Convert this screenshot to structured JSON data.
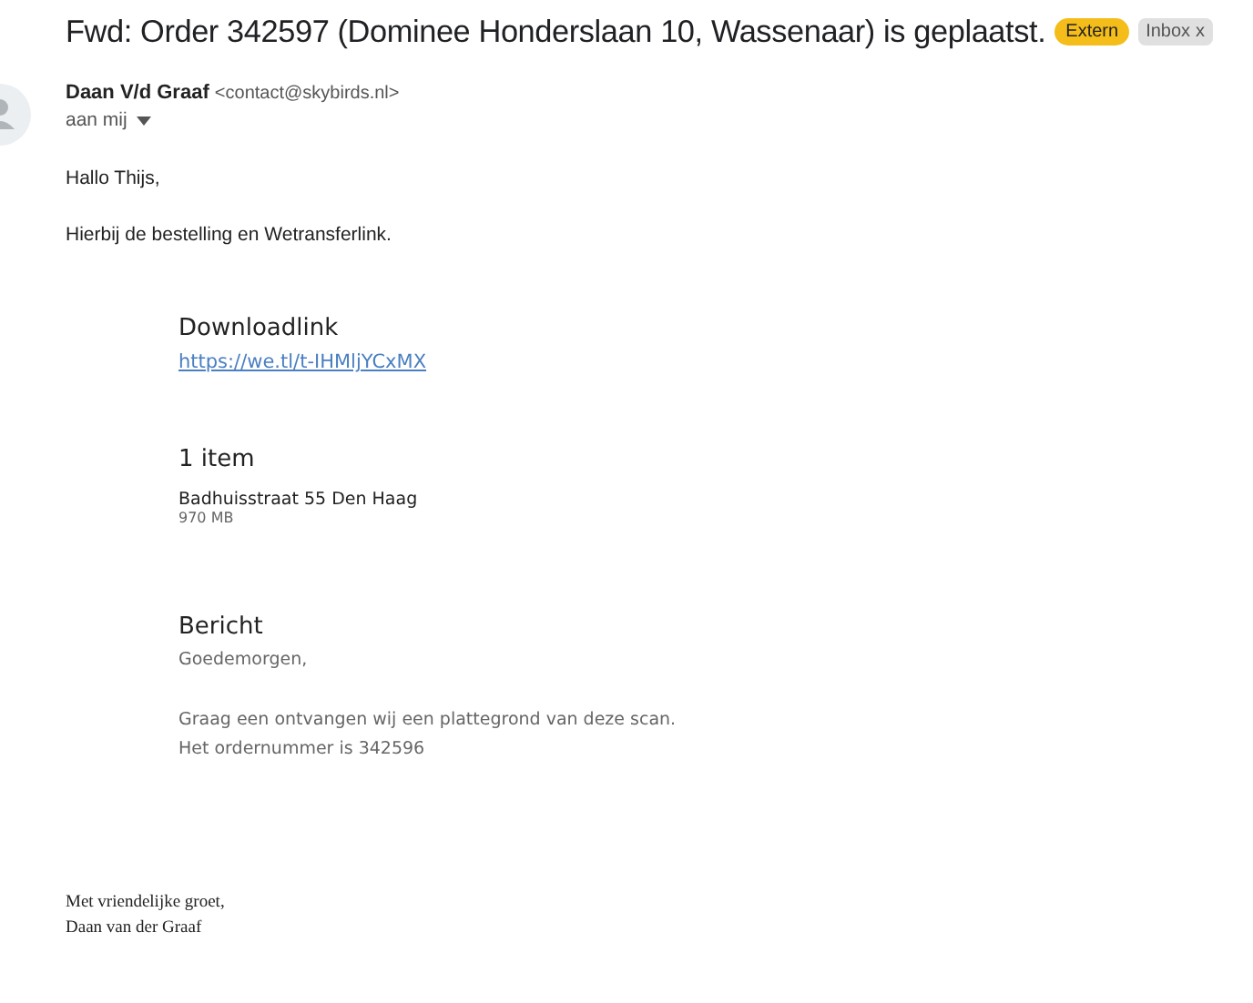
{
  "subject": "Fwd: Order 342597 (Dominee Honderslaan 10, Wassenaar) is geplaatst.",
  "labels": [
    {
      "text": "Extern",
      "kind": "tag",
      "removable": false
    },
    {
      "text": "Inbox",
      "kind": "folder",
      "removable": true,
      "remove_glyph": "x"
    }
  ],
  "sender": {
    "name": "Daan V/d Graaf",
    "email": "<contact@skybirds.nl>",
    "recipient": "aan mij"
  },
  "intro": [
    "Hallo Thijs,",
    "Hierbij de bestelling en Wetransferlink."
  ],
  "transfer": {
    "download_heading": "Downloadlink",
    "link": "https://we.tl/t-IHMljYCxMX",
    "items_heading": "1 item",
    "file_name": "Badhuisstraat 55 Den Haag",
    "file_size": "970 MB",
    "message_heading": "Bericht",
    "message": [
      "Goedemorgen,",
      "Graag een ontvangen wij een plattegrond van deze scan.",
      "Het ordernummer is 342596"
    ]
  },
  "signature": [
    "Met vriendelijke groet,",
    "Daan van der Graaf"
  ]
}
